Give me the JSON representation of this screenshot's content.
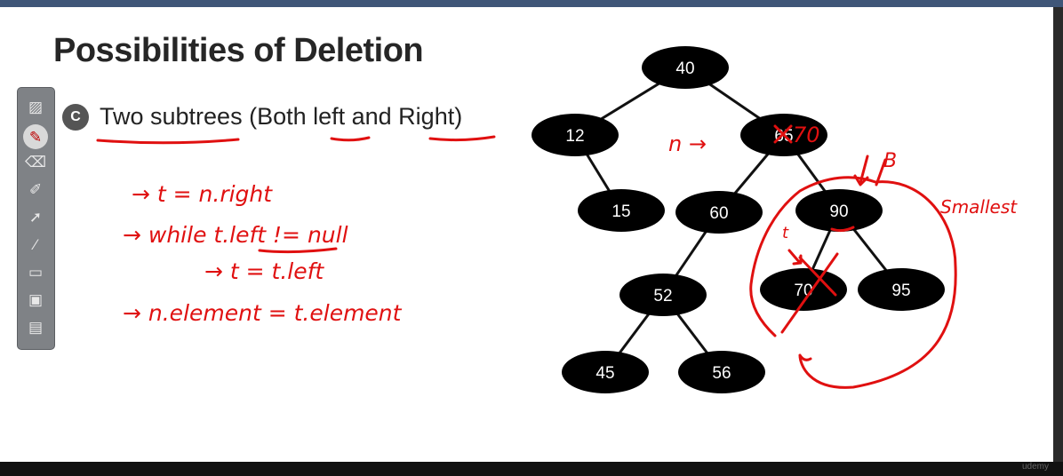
{
  "slide": {
    "title": "Possibilities of Deletion",
    "bullet": {
      "badge": "C",
      "text": "Two subtrees (Both left and Right)"
    }
  },
  "annotations": {
    "code_lines": [
      "→ t = n.right",
      "→ while t.left != null",
      "→ t = t.left",
      "→ n.element = t.element"
    ],
    "n_arrow": "n →",
    "replaced_node_value": "70",
    "t_label": "t",
    "smallest_label": "Smallest",
    "b_mark": "B"
  },
  "tree": {
    "nodes": [
      {
        "id": "n40",
        "label": "40"
      },
      {
        "id": "n12",
        "label": "12"
      },
      {
        "id": "n65",
        "label": "65"
      },
      {
        "id": "n15",
        "label": "15"
      },
      {
        "id": "n60",
        "label": "60"
      },
      {
        "id": "n90",
        "label": "90"
      },
      {
        "id": "n52",
        "label": "52"
      },
      {
        "id": "n70",
        "label": "70"
      },
      {
        "id": "n95",
        "label": "95"
      },
      {
        "id": "n45",
        "label": "45"
      },
      {
        "id": "n56",
        "label": "56"
      }
    ],
    "edges": [
      [
        "n40",
        "n12"
      ],
      [
        "n40",
        "n65"
      ],
      [
        "n12",
        "n15"
      ],
      [
        "n65",
        "n60"
      ],
      [
        "n65",
        "n90"
      ],
      [
        "n60",
        "n52"
      ],
      [
        "n90",
        "n70"
      ],
      [
        "n90",
        "n95"
      ],
      [
        "n52",
        "n45"
      ],
      [
        "n52",
        "n56"
      ]
    ]
  },
  "toolbar": {
    "tools": [
      {
        "name": "highlighter-tool-icon",
        "glyph": "▨"
      },
      {
        "name": "pen-tool-icon",
        "glyph": "✎"
      },
      {
        "name": "eraser-tool-icon",
        "glyph": "⌫"
      },
      {
        "name": "marker-tool-icon",
        "glyph": "✐"
      },
      {
        "name": "pointer-tool-icon",
        "glyph": "➚"
      },
      {
        "name": "brush-tool-icon",
        "glyph": "⁄"
      },
      {
        "name": "keyboard-tool-icon",
        "glyph": "▭"
      },
      {
        "name": "monitor-tool-icon",
        "glyph": "▣"
      },
      {
        "name": "screen-capture-tool-icon",
        "glyph": "▤"
      }
    ]
  },
  "watermark": "udemy"
}
